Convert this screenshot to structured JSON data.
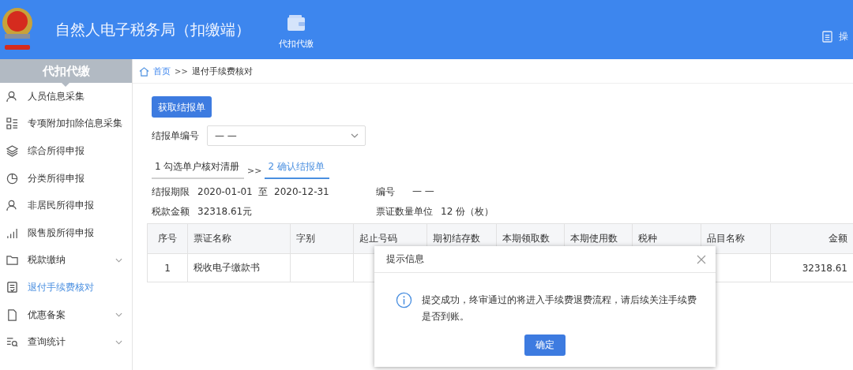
{
  "app": {
    "title": "自然人电子税务局（扣缴端）",
    "top_nav": [
      {
        "label": "代扣代缴",
        "selected": true
      }
    ],
    "top_right": "操"
  },
  "sidebar": {
    "heading": "代扣代缴",
    "items": [
      {
        "label": "人员信息采集",
        "selected": false,
        "expandable": false
      },
      {
        "label": "专项附加扣除信息采集",
        "selected": false,
        "expandable": false
      },
      {
        "label": "综合所得申报",
        "selected": false,
        "expandable": false
      },
      {
        "label": "分类所得申报",
        "selected": false,
        "expandable": false
      },
      {
        "label": "非居民所得申报",
        "selected": false,
        "expandable": false
      },
      {
        "label": "限售股所得申报",
        "selected": false,
        "expandable": false
      },
      {
        "label": "税款缴纳",
        "selected": false,
        "expandable": true
      },
      {
        "label": "退付手续费核对",
        "selected": true,
        "expandable": false
      },
      {
        "label": "优惠备案",
        "selected": false,
        "expandable": true
      },
      {
        "label": "查询统计",
        "selected": false,
        "expandable": true
      }
    ]
  },
  "breadcrumb": [
    "首页",
    "退付手续费核对"
  ],
  "breadcrumb_separator": ">>",
  "fetch_button": "获取结报单",
  "report_number": {
    "label": "结报单编号",
    "value": "— —"
  },
  "steps": [
    {
      "label": "1 勾选单户核对清册",
      "selected": false
    },
    {
      "label": "2 确认结报单",
      "selected": true
    }
  ],
  "step_separator": ">>",
  "summary": {
    "period": {
      "label": "结报期限",
      "value": "2020-01-01  至  2020-12-31"
    },
    "number": {
      "label": "编号",
      "value": "— —"
    },
    "tax_amount": {
      "label": "税款金额",
      "value": "32318.61元"
    },
    "voucher_count": {
      "label": "票证数量单位",
      "value": "12 份（枚）"
    }
  },
  "table": {
    "columns": [
      "序号",
      "票证名称",
      "字别",
      "起止号码",
      "期初结存数",
      "本期领取数",
      "本期使用数",
      "税种",
      "品目名称",
      "金额"
    ],
    "rows": [
      [
        "1",
        "税收电子缴款书",
        "",
        "",
        "",
        "",
        "",
        "",
        "",
        "32318.61"
      ]
    ]
  },
  "dialog": {
    "title": "提示信息",
    "message": "提交成功，终审通过的将进入手续费退费流程，请后续关注手续费是否到账。",
    "button": "确定"
  }
}
